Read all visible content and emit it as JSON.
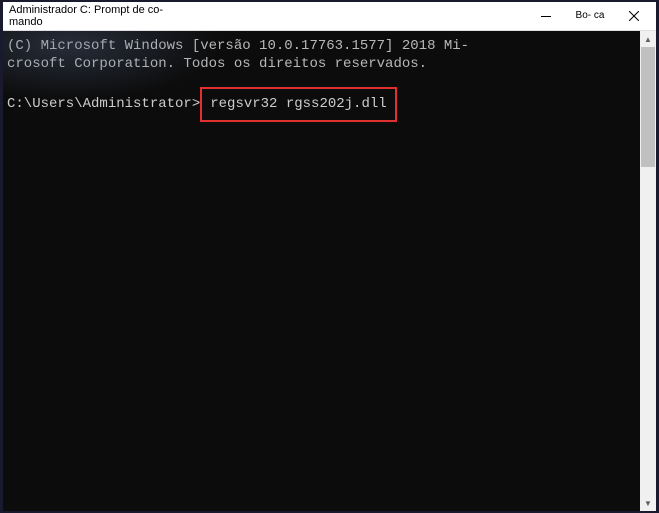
{
  "window": {
    "title": "Administrador C: Prompt de co- mando",
    "maximize_label": "Bo- ca"
  },
  "terminal": {
    "copyright": "(C) Microsoft Windows [versão 10.0.17763.1577] 2018 Mi- crosoft Corporation. Todos os direitos reservados.",
    "prompt_path": "C:\\Users\\Administrator>",
    "command": "regsvr32 rgss202j.dll"
  }
}
